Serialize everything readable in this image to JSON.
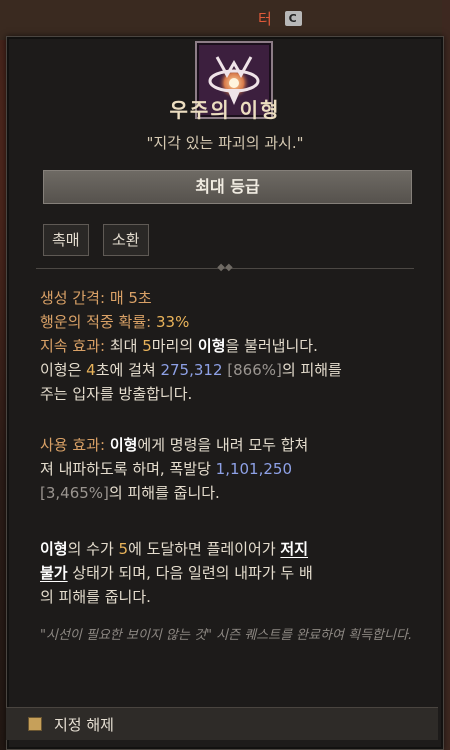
{
  "top_bar": {
    "partial_label": "터",
    "key_hint": "C"
  },
  "skill": {
    "icon": "arcane-tripod-emblem-icon",
    "title": "우주의 이형",
    "flavor": "\"지각 있는 파괴의 과시.\"",
    "rank_label": "최대 등급",
    "tags": [
      "촉매",
      "소환"
    ]
  },
  "stats": {
    "spawn_label": "생성 간격:",
    "spawn_value": "매 5초",
    "luck_label": "행운의 적중 확률:",
    "luck_value": "33%"
  },
  "passive": {
    "label": "지속 효과:",
    "t1": "최대 ",
    "count": "5",
    "t2": "마리의 ",
    "name": "이형",
    "t3": "을 불러냅니다.",
    "t4": "이형은 ",
    "seconds": "4",
    "t5": "초에 걸쳐 ",
    "damage": "275,312",
    "damage_pct": "[866%]",
    "t6": "의 피해를",
    "t7": "주는 입자를 방출합니다."
  },
  "active": {
    "label": "사용 효과:",
    "name": "이형",
    "t1": "에게 명령을 내려 모두 합쳐",
    "t2": "져 내파하도록 하며, 폭발당 ",
    "damage": "1,101,250",
    "damage_pct": "[3,465%]",
    "t3": "의 피해를 줍니다."
  },
  "bonus": {
    "name": "이형",
    "t1": "의 수가 ",
    "count": "5",
    "t2": "에 도달하면 플레이어가 ",
    "keyword_a": "저지",
    "keyword_b": "불가",
    "t3": " 상태가 되며, 다음 일련의 내파가 두 배",
    "t4": "의 피해를 줍니다."
  },
  "note": "\"시선이 필요한 보이지 않는 것\" 시즌 퀘스트를 완료하여 획득합니다.",
  "footer": {
    "icon": "unassign-icon",
    "label": "지정 해제"
  }
}
